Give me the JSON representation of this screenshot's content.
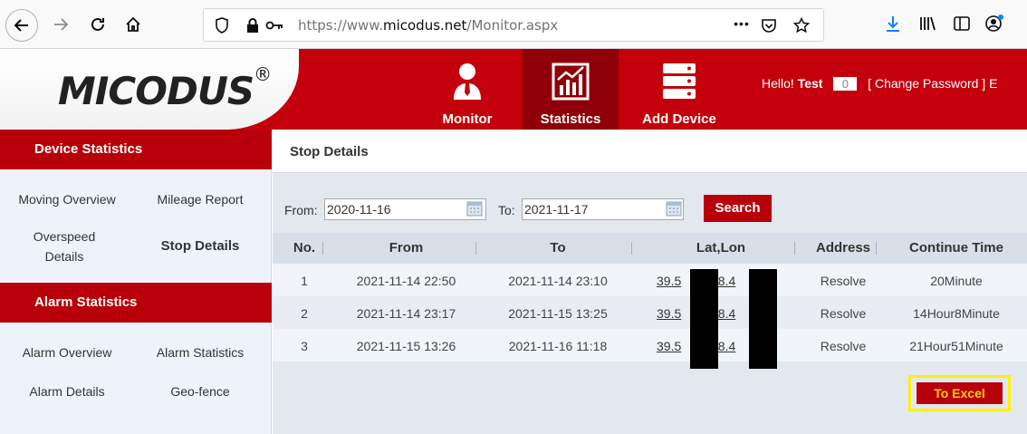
{
  "browser": {
    "url_prefix": "https://www.",
    "url_domain": "micodus.net",
    "url_path": "/Monitor.aspx",
    "more_label": "•••"
  },
  "header": {
    "logo": "MICODUS",
    "logo_reg": "®",
    "nav": [
      {
        "label": "Monitor",
        "icon": "person-icon"
      },
      {
        "label": "Statistics",
        "icon": "chart-icon"
      },
      {
        "label": "Add Device",
        "icon": "server-icon"
      }
    ],
    "hello_prefix": "Hello!",
    "user": "Test",
    "badge": "0",
    "change_password": "[ Change Password ]",
    "trailing": "E"
  },
  "sidebar": {
    "device_stats_title": "Device Statistics",
    "device_links": [
      "Moving Overview",
      "Mileage Report",
      "Overspeed Details",
      "Stop Details"
    ],
    "alarm_stats_title": "Alarm Statistics",
    "alarm_links": [
      "Alarm Overview",
      "Alarm Statistics",
      "Alarm Details",
      "Geo-fence"
    ]
  },
  "main": {
    "title": "Stop Details",
    "from_label": "From:",
    "from_value": "2020-11-16",
    "to_label": "To:",
    "to_value": "2021-11-17",
    "search_label": "Search",
    "columns": [
      "No.",
      "From",
      "To",
      "Lat,Lon",
      "Address",
      "Continue Time"
    ],
    "rows": [
      {
        "no": "1",
        "from": "2021-11-14 22:50",
        "to": "2021-11-14 23:10",
        "lat": "39.5",
        "lon": ",-8.4",
        "address": "Resolve",
        "duration": "20Minute"
      },
      {
        "no": "2",
        "from": "2021-11-14 23:17",
        "to": "2021-11-15 13:25",
        "lat": "39.5",
        "lon": ",-8.4",
        "address": "Resolve",
        "duration": "14Hour8Minute"
      },
      {
        "no": "3",
        "from": "2021-11-15 13:26",
        "to": "2021-11-16 11:18",
        "lat": "39.5",
        "lon": ",-8.4",
        "address": "Resolve",
        "duration": "21Hour51Minute"
      }
    ],
    "excel_label": "To Excel"
  },
  "colors": {
    "brand_red": "#c4000c",
    "active_red": "#8f0008",
    "highlight": "#fff000"
  }
}
